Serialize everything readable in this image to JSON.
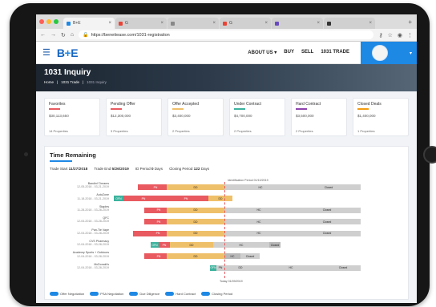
{
  "browser": {
    "tabs": [
      {
        "title": "B+E",
        "active": true,
        "favicon_color": "#1e88e5"
      },
      {
        "title": "G",
        "active": false,
        "favicon_color": "#ea4335"
      },
      {
        "title": "",
        "active": false,
        "favicon_color": "#888888"
      },
      {
        "title": "G",
        "active": false,
        "favicon_color": "#ea4335"
      },
      {
        "title": "",
        "active": false,
        "favicon_color": "#6a4bbf"
      },
      {
        "title": "",
        "active": false,
        "favicon_color": "#333333"
      }
    ],
    "url": "https://beneitease.com/1031-registration",
    "traffic_colors": [
      "#ff5f57",
      "#febc2e",
      "#28c840"
    ]
  },
  "header": {
    "logo_b": "B",
    "logo_plus": "+",
    "logo_e": "E",
    "nav": [
      "ABOUT US ▾",
      "BUY",
      "SELL",
      "1031 TRADE"
    ],
    "accent": "#1e88e5"
  },
  "hero": {
    "title": "1031 Inquiry",
    "crumbs": [
      "Home",
      "1031 Trade",
      "1031 Inquiry"
    ]
  },
  "stages": [
    {
      "label": "Favorites",
      "color": "#e85a60",
      "amount": "$30,113,650",
      "props": "14 Properties"
    },
    {
      "label": "Pending Offer",
      "color": "#e85a60",
      "amount": "$12,300,000",
      "props": "3 Properties"
    },
    {
      "label": "Offer Accepted",
      "color": "#efc06a",
      "amount": "$3,400,000",
      "props": "2 Properties"
    },
    {
      "label": "Under Contract",
      "color": "#3db39e",
      "amount": "$4,700,000",
      "props": "2 Properties"
    },
    {
      "label": "Hard Contract",
      "color": "#8e44ad",
      "amount": "$3,500,000",
      "props": "2 Properties"
    },
    {
      "label": "Closed Deals",
      "color": "#f39c12",
      "amount": "$1,400,000",
      "props": "1 Properties"
    }
  ],
  "timeline": {
    "title": "Time Remaining",
    "trade_start_label": "Trade Start",
    "trade_start": "11/27/2018",
    "trade_end_label": "Trade End",
    "trade_end": "5/26/2019",
    "id_period_label": "ID Period",
    "id_period": "0",
    "id_unit": "Days",
    "closing_label": "Closing Period",
    "closing": "122",
    "closing_unit": "Days",
    "identification_label": "Identification Period",
    "identification_date": "01/10/2019",
    "today_label": "Today",
    "today_date": "01/09/2019",
    "rows": [
      {
        "name": "Bandini' Dreams",
        "dates": "12-05-2018 - 03-21-2019"
      },
      {
        "name": "AutoZone",
        "dates": "11-18-2018 - 03-21-2019"
      },
      {
        "name": "Staples",
        "dates": "11-28-2018 - 03-28-2019"
      },
      {
        "name": "QFC",
        "dates": "12-04-2018 - 03-28-2019"
      },
      {
        "name": "Pan-Tie Vape",
        "dates": "12-04-2018 - 03-28-2019"
      },
      {
        "name": "CVS Pharmacy",
        "dates": "12-04-2018 - 03-28-2019"
      },
      {
        "name": "Academy Sports + Outdoors",
        "dates": "12-04-2018 - 03-28-2019"
      },
      {
        "name": "McDonald's",
        "dates": "12-04-2018 - 03-28-2019"
      }
    ],
    "seg_labels": {
      "ofn": "OFN",
      "pn": "PN",
      "dd": "DD",
      "hc": "HC",
      "closed": "Closed"
    },
    "legend": [
      {
        "chip": "OFN",
        "label": "Offer Negotiation"
      },
      {
        "chip": "PN",
        "label": "PSA Negotiation"
      },
      {
        "chip": "DD",
        "label": "Due Diligence"
      },
      {
        "chip": "HC",
        "label": "Hard Contract"
      },
      {
        "chip": "Closed",
        "label": "Closing Period"
      }
    ]
  }
}
